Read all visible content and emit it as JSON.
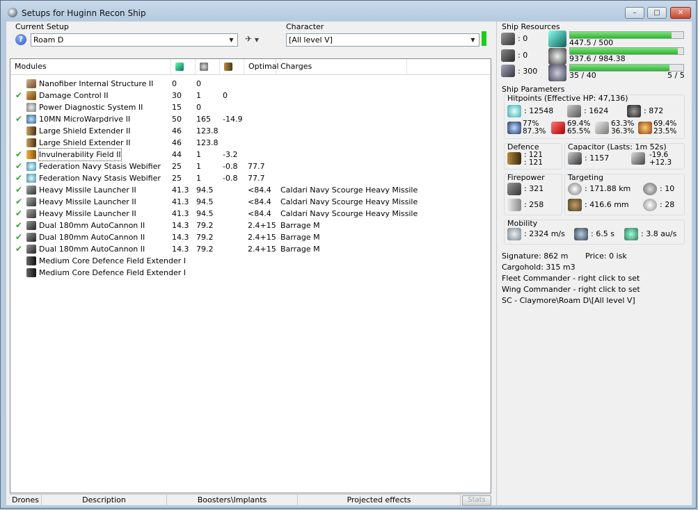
{
  "window": {
    "title": "Setups for Huginn Recon Ship"
  },
  "setup": {
    "label": "Current Setup",
    "value": "Roam D"
  },
  "character": {
    "label": "Character",
    "value": "[All level V]"
  },
  "accent_green": "#18d018",
  "modules_table": {
    "headers": [
      "Modules",
      "Optimal",
      "Charges"
    ],
    "rows": [
      {
        "check": false,
        "icon": "armor-icon",
        "name": "Nanofiber Internal Structure II",
        "cpu": "0",
        "pg": "0",
        "cap": "",
        "optimal": "",
        "charges": ""
      },
      {
        "check": true,
        "icon": "damage-control-icon",
        "name": "Damage Control II",
        "cpu": "30",
        "pg": "1",
        "cap": "0",
        "optimal": "",
        "charges": ""
      },
      {
        "check": false,
        "icon": "power-icon",
        "name": "Power Diagnostic System II",
        "cpu": "15",
        "pg": "0",
        "cap": "",
        "optimal": "",
        "charges": ""
      },
      {
        "check": true,
        "icon": "propulsion-icon",
        "name": "10MN MicroWarpdrive II",
        "cpu": "50",
        "pg": "165",
        "cap": "-14.9",
        "optimal": "",
        "charges": ""
      },
      {
        "check": false,
        "icon": "shield-extender-icon",
        "name": "Large Shield Extender II",
        "cpu": "46",
        "pg": "123.8",
        "cap": "",
        "optimal": "",
        "charges": ""
      },
      {
        "check": false,
        "icon": "shield-extender-icon",
        "name": "Large Shield Extender II",
        "cpu": "46",
        "pg": "123.8",
        "cap": "",
        "optimal": "",
        "charges": ""
      },
      {
        "check": true,
        "icon": "invulnerability-icon",
        "name": "Invulnerability Field II",
        "cpu": "44",
        "pg": "1",
        "cap": "-3.2",
        "optimal": "",
        "charges": "",
        "selected": true
      },
      {
        "check": true,
        "icon": "webifier-icon",
        "name": "Federation Navy Stasis Webifier",
        "cpu": "25",
        "pg": "1",
        "cap": "-0.8",
        "optimal": "77.7",
        "charges": ""
      },
      {
        "check": true,
        "icon": "webifier-icon",
        "name": "Federation Navy Stasis Webifier",
        "cpu": "25",
        "pg": "1",
        "cap": "-0.8",
        "optimal": "77.7",
        "charges": ""
      },
      {
        "check": true,
        "icon": "missile-launcher-icon",
        "name": "Heavy Missile Launcher II",
        "cpu": "41.3",
        "pg": "94.5",
        "cap": "",
        "optimal": "<84.4",
        "charges": "Caldari Navy Scourge Heavy Missile"
      },
      {
        "check": true,
        "icon": "missile-launcher-icon",
        "name": "Heavy Missile Launcher II",
        "cpu": "41.3",
        "pg": "94.5",
        "cap": "",
        "optimal": "<84.4",
        "charges": "Caldari Navy Scourge Heavy Missile"
      },
      {
        "check": true,
        "icon": "missile-launcher-icon",
        "name": "Heavy Missile Launcher II",
        "cpu": "41.3",
        "pg": "94.5",
        "cap": "",
        "optimal": "<84.4",
        "charges": "Caldari Navy Scourge Heavy Missile"
      },
      {
        "check": true,
        "icon": "autocannon-icon",
        "name": "Dual 180mm AutoCannon II",
        "cpu": "14.3",
        "pg": "79.2",
        "cap": "",
        "optimal": "2.4+15",
        "charges": "Barrage M"
      },
      {
        "check": true,
        "icon": "autocannon-icon",
        "name": "Dual 180mm AutoCannon II",
        "cpu": "14.3",
        "pg": "79.2",
        "cap": "",
        "optimal": "2.4+15",
        "charges": "Barrage M"
      },
      {
        "check": true,
        "icon": "autocannon-icon",
        "name": "Dual 180mm AutoCannon II",
        "cpu": "14.3",
        "pg": "79.2",
        "cap": "",
        "optimal": "2.4+15",
        "charges": "Barrage M"
      },
      {
        "check": false,
        "icon": "rig-icon",
        "name": "Medium Core Defence Field Extender I",
        "cpu": "",
        "pg": "",
        "cap": "",
        "optimal": "",
        "charges": ""
      },
      {
        "check": false,
        "icon": "rig-icon",
        "name": "Medium Core Defence Field Extender I",
        "cpu": "",
        "pg": "",
        "cap": "",
        "optimal": "",
        "charges": ""
      }
    ]
  },
  "bottom_tabs": [
    "Drones",
    "Description",
    "Boosters\\Implants",
    "Projected effects"
  ],
  "stats_button": "Stats",
  "resources": {
    "label": "Ship Resources",
    "turret_slots": ": 0",
    "launcher_slots": ": 0",
    "calibration": ": 300",
    "cpu": "447.5 / 500",
    "cpu_fraction": 0.895,
    "powergrid": "937.6 / 984.38",
    "powergrid_fraction": 0.952,
    "drone_bay": "35 / 40",
    "drone_bay_fraction": 0.875,
    "drones_active": "5 / 5"
  },
  "parameters": {
    "label": "Ship Parameters",
    "hitpoints_label": "Hitpoints (Effective HP: 47,136)",
    "shield_hp": ": 12548",
    "armor_hp": ": 1624",
    "structure_hp": ": 872",
    "em_res": [
      "77%",
      "87.3%"
    ],
    "thermal_res": [
      "69.4%",
      "65.5%"
    ],
    "kinetic_res": [
      "63.3%",
      "36.3%"
    ],
    "explosive_res": [
      "69.4%",
      "23.5%"
    ],
    "defence_label": "Defence",
    "defence_values": [
      ": 121",
      ": 121"
    ],
    "capacitor_label": "Capacitor (Lasts: 1m 52s)",
    "capacitor_value": ": 1157",
    "capacitor_delta": [
      "-19.6",
      "+12.3"
    ],
    "firepower_label": "Firepower",
    "firepower_volley": ": 321",
    "firepower_dps": ": 258",
    "targeting_label": "Targeting",
    "target_range": ": 171.88 km",
    "max_targets": ": 10",
    "scan_res": ": 416.6 mm",
    "sensor_strength": ": 28",
    "mobility_label": "Mobility",
    "velocity": ": 2324 m/s",
    "align_time": ": 6.5 s",
    "warp_speed": ": 3.8 au/s"
  },
  "info": {
    "signature": "Signature: 862 m",
    "price": "Price: 0 isk",
    "cargohold": "Cargohold: 315 m3",
    "fleet_commander": "Fleet Commander - right click to set",
    "wing_commander": "Wing Commander - right click to set",
    "sc_path": "SC - Claymore\\Roam D\\[All level V]"
  }
}
